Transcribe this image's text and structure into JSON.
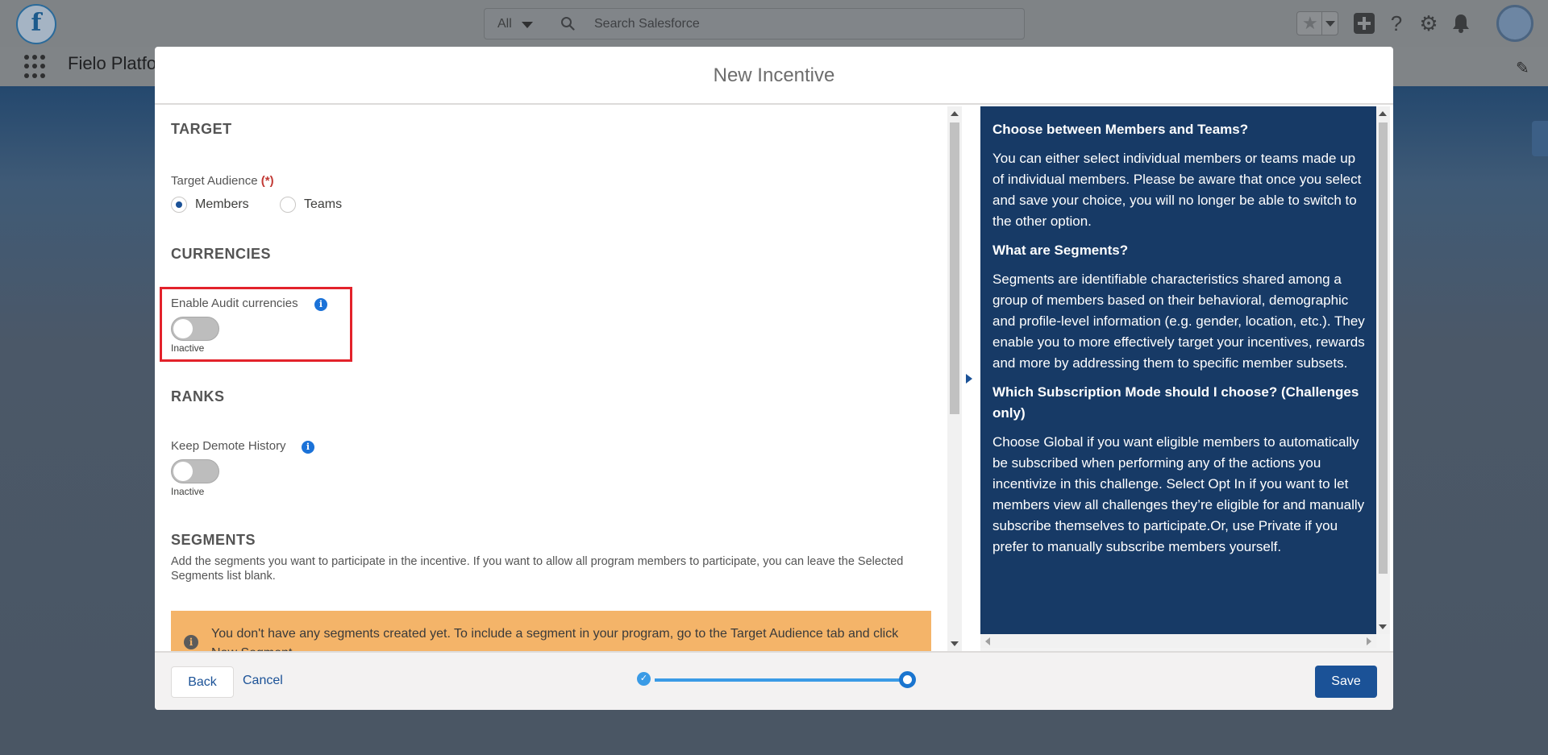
{
  "app": {
    "logo_letter": "f",
    "app_name": "Fielo Platfo",
    "search_scope": "All",
    "search_placeholder": "Search Salesforce"
  },
  "modal": {
    "title": "New Incentive",
    "target": {
      "title": "TARGET",
      "audience_label": "Target Audience",
      "required_marker": "(*)",
      "options": [
        "Members",
        "Teams"
      ],
      "selected": "Members"
    },
    "currencies": {
      "title": "CURRENCIES",
      "audit_label": "Enable Audit currencies",
      "audit_status": "Inactive"
    },
    "ranks": {
      "title": "RANKS",
      "demote_label": "Keep Demote History",
      "demote_status": "Inactive"
    },
    "segments": {
      "title": "SEGMENTS",
      "description": "Add the segments you want to participate in the incentive. If you want to allow all program members to participate, you can leave the Selected Segments list blank.",
      "warning": "You don't have any segments created yet. To include a segment in your program, go to the Target Audience tab and click New Segment."
    },
    "help": [
      {
        "q": "Choose between Members and Teams?",
        "a": "You can either select individual members or teams made up of individual members. Please be aware that once you select and save your choice, you will no longer be able to switch to the other option."
      },
      {
        "q": "What are Segments?",
        "a": "Segments are identifiable characteristics shared among a group of members based on their behavioral, demographic and profile-level information (e.g. gender, location, etc.). They enable you to more effectively target your incentives, rewards and more by addressing them to specific member subsets."
      },
      {
        "q": "Which Subscription Mode should I choose? (Challenges only)",
        "a": "Choose Global if you want eligible members to automatically be subscribed when performing any of the actions you incentivize in this challenge. Select Opt In if you want to let members view all challenges they’re eligible for and manually subscribe themselves to participate.Or, use Private if you prefer to manually subscribe members yourself."
      }
    ],
    "footer": {
      "back": "Back",
      "cancel": "Cancel",
      "save": "Save"
    }
  },
  "colors": {
    "brand_blue": "#1b5297",
    "help_panel": "#173a66",
    "warning": "#f4b469",
    "highlight": "#e3222b"
  }
}
